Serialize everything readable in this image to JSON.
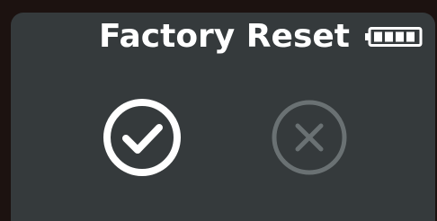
{
  "screen": {
    "title": "Factory Reset"
  },
  "battery": {
    "icon": "battery-full-icon",
    "level": 1.0,
    "color": "#ffffff"
  },
  "actions": {
    "confirm": {
      "icon": "check-circle-icon",
      "color": "#ffffff"
    },
    "cancel": {
      "icon": "x-circle-icon",
      "color": "#6a7173"
    }
  },
  "colors": {
    "background": "#353a3c",
    "bezel": "#1c1210"
  }
}
